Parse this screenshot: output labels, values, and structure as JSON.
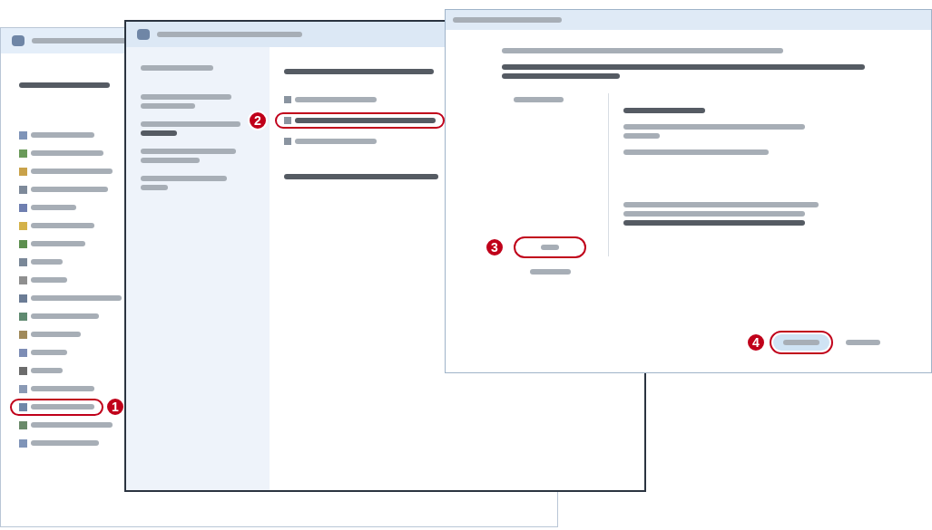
{
  "control_panel": {
    "items": [
      {
        "marked": false
      },
      {
        "marked": false
      },
      {
        "marked": false
      },
      {
        "marked": false
      },
      {
        "marked": false
      },
      {
        "marked": false
      },
      {
        "marked": false
      },
      {
        "marked": false
      },
      {
        "marked": false
      },
      {
        "marked": false
      },
      {
        "marked": false
      },
      {
        "marked": false
      },
      {
        "marked": false
      },
      {
        "marked": false
      },
      {
        "marked": false
      },
      {
        "marked": true,
        "callout": "1"
      },
      {
        "marked": false
      },
      {
        "marked": false
      }
    ]
  },
  "system_window": {
    "options": [
      {
        "marked": false
      },
      {
        "marked": true,
        "callout": "2"
      },
      {
        "marked": false
      }
    ]
  },
  "dialog": {
    "choices": [
      {
        "marked": true,
        "callout": "3"
      },
      {
        "marked": false
      }
    ],
    "buttons": [
      {
        "kind": "primary",
        "marked": true,
        "callout": "4"
      },
      {
        "kind": "secondary",
        "marked": false
      }
    ]
  }
}
